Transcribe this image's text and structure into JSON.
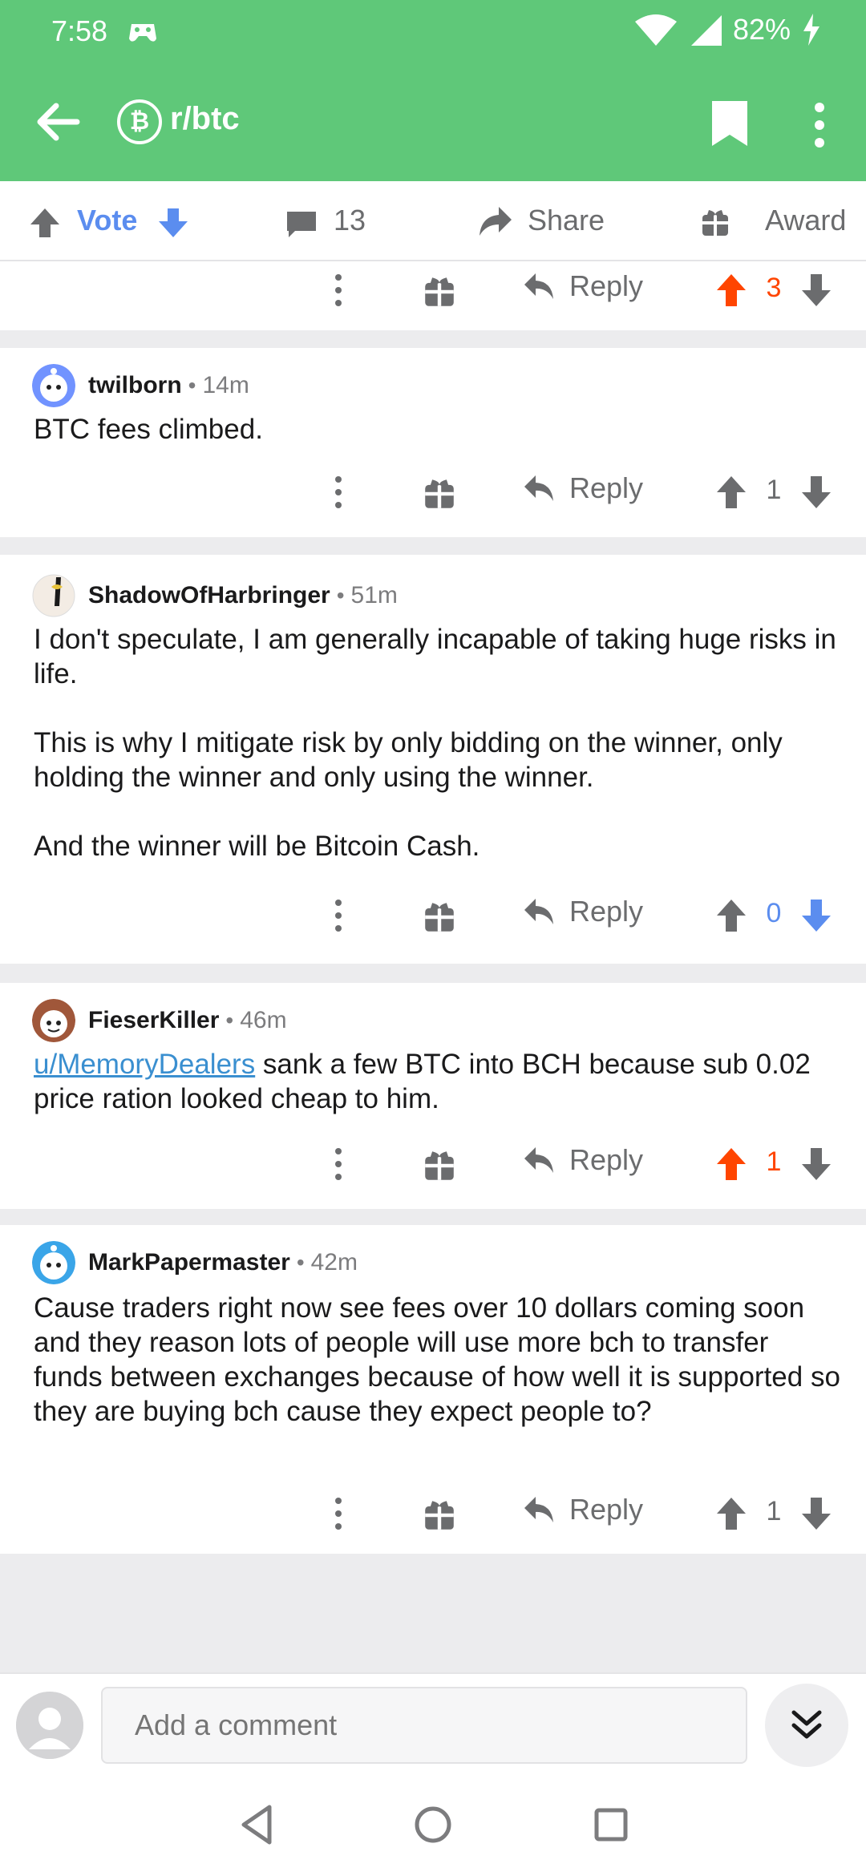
{
  "status_bar": {
    "time": "7:58",
    "battery": "82%"
  },
  "app_bar": {
    "subreddit": "r/btc",
    "subreddit_icon_letter": "₿"
  },
  "action_bar": {
    "vote_label": "Vote",
    "comment_count": "13",
    "share_label": "Share",
    "award_label": "Award"
  },
  "top_controls": {
    "reply_label": "Reply",
    "score": "3",
    "vote_state": "up"
  },
  "comments": [
    {
      "author": "twilborn",
      "age": "14m",
      "paragraphs": [
        "BTC fees climbed."
      ],
      "reply_label": "Reply",
      "score": "1",
      "vote_state": "none"
    },
    {
      "author": "ShadowOfHarbringer",
      "age": "51m",
      "paragraphs": [
        "I don't speculate, I am generally incapable of taking huge risks in life.",
        "This is why I mitigate risk by only bidding on the winner, only holding the winner and only using the winner.",
        "And the winner will be Bitcoin Cash."
      ],
      "reply_label": "Reply",
      "score": "0",
      "vote_state": "down"
    },
    {
      "author": "FieserKiller",
      "age": "46m",
      "link": "u/MemoryDealers",
      "body_after_link": " sank a few BTC into BCH because sub 0.02 price ration looked cheap to him.",
      "reply_label": "Reply",
      "score": "1",
      "vote_state": "up"
    },
    {
      "author": "MarkPapermaster",
      "age": "42m",
      "paragraphs": [
        "Cause traders right now see  fees over 10 dollars coming soon and they reason lots of people will use more bch to transfer funds between exchanges because of how well it is supported so they are buying bch cause they expect people to?"
      ],
      "reply_label": "Reply",
      "score": "1",
      "vote_state": "none"
    }
  ],
  "composer": {
    "placeholder": "Add a comment"
  },
  "colors": {
    "header_green": "#5fc879",
    "upvote_orange": "#ff4500",
    "downvote_blue": "#5b8def",
    "link_blue": "#3a8fd0",
    "icon_gray": "#6b6c6e"
  },
  "icons": [
    "back-arrow",
    "bitcoin",
    "bookmark",
    "overflow-menu",
    "upvote",
    "downvote",
    "comment",
    "share",
    "gift",
    "reply",
    "collapse",
    "nav-back",
    "nav-home",
    "nav-recents"
  ]
}
